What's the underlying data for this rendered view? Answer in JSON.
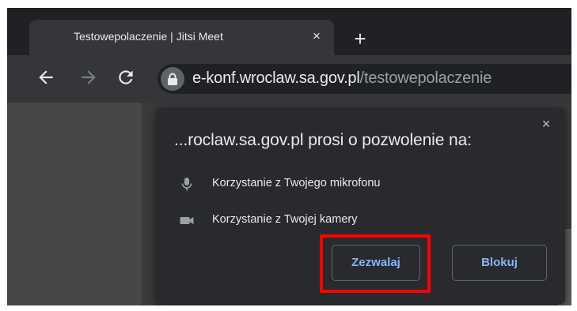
{
  "tab": {
    "title": "Testowepolaczenie | Jitsi Meet",
    "close_glyph": "×",
    "new_tab_glyph": "+"
  },
  "toolbar": {
    "back_icon": "arrow-left-icon",
    "forward_icon": "arrow-right-icon",
    "reload_icon": "reload-icon"
  },
  "omnibox": {
    "lock_icon": "lock-icon",
    "url_host": "e-konf.wroclaw.sa.gov.pl",
    "url_path": "/testowepolaczenie"
  },
  "permission_bubble": {
    "title": "...roclaw.sa.gov.pl prosi o pozwolenie na:",
    "close_glyph": "×",
    "permissions": [
      {
        "icon": "microphone-icon",
        "label": "Korzystanie z Twojego mikrofonu"
      },
      {
        "icon": "camera-icon",
        "label": "Korzystanie z Twojej kamery"
      }
    ],
    "allow_label": "Zezwalaj",
    "block_label": "Blokuj"
  },
  "annotation": {
    "highlight_color": "#ff0000"
  },
  "colors": {
    "tabstrip_bg": "#202124",
    "toolbar_bg": "#35363a",
    "bubble_bg": "#292a2d",
    "button_text": "#8ab4f8",
    "text_primary": "#e8eaed",
    "text_secondary": "#9aa0a6"
  }
}
